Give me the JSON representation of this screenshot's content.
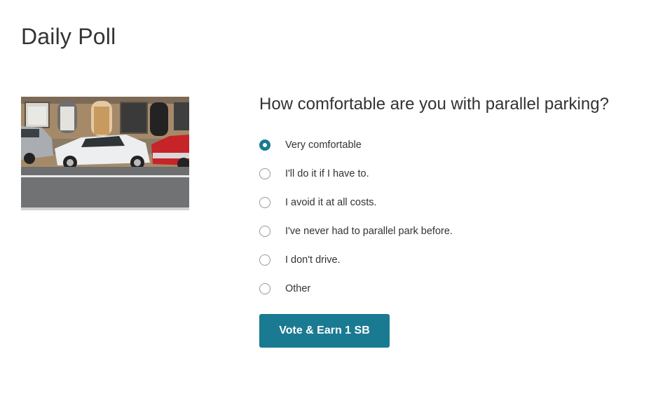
{
  "page": {
    "title": "Daily Poll"
  },
  "poll": {
    "image_alt": "Cars parallel parked on a city street",
    "question": "How comfortable are you with parallel parking?",
    "options": [
      {
        "label": "Very comfortable",
        "selected": true
      },
      {
        "label": "I'll do it if I have to.",
        "selected": false
      },
      {
        "label": "I avoid it at all costs.",
        "selected": false
      },
      {
        "label": "I've never had to parallel park before.",
        "selected": false
      },
      {
        "label": "I don't drive.",
        "selected": false
      },
      {
        "label": "Other",
        "selected": false
      }
    ],
    "submit_label": "Vote & Earn 1 SB"
  },
  "colors": {
    "accent": "#1a7a91",
    "text": "#333333",
    "radio_border": "#999999"
  }
}
